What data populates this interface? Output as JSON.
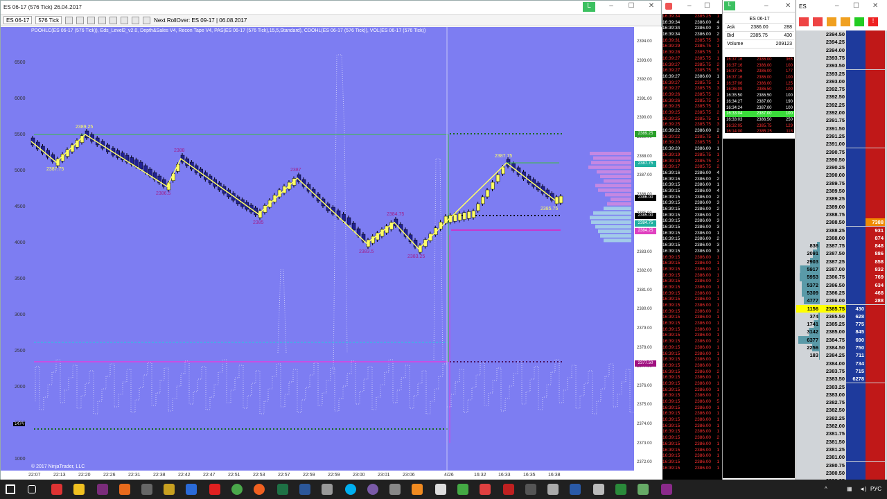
{
  "chart_window": {
    "title": "ES 06-17 (576 Tick)  26.04.2017",
    "instrument": "ES 06-17",
    "period": "576 Tick",
    "rollover": "Next RollOver:  ES 09-17 | 06.08.2017",
    "indicators": "PDOHLC(ES 06-17 (576 Tick)), Eds_Level2_v2.0, Depth&Sales V4, Recon Tape V4, PAS(ES 06-17 (576 Tick),15,5,Standard), CDOHL(ES 06-17 (576 Tick)), VOL(ES 06-17 (576 Tick))",
    "copyright": "© 2017 NinjaTrader, LLC",
    "panel_badge": "1474",
    "left_axis": [
      "6500",
      "6000",
      "5500",
      "5000",
      "4500",
      "4000",
      "3500",
      "3000",
      "2500",
      "2000",
      "1500",
      "1000"
    ],
    "right_axis": [
      "2394.00",
      "2393.00",
      "2392.00",
      "2391.00",
      "2390.00",
      "2389.00",
      "2388.00",
      "2387.00",
      "2386.00",
      "2385.00",
      "2384.00",
      "2383.00",
      "2382.00",
      "2381.00",
      "2380.00",
      "2379.00",
      "2378.00",
      "2377.00",
      "2376.00",
      "2375.00",
      "2374.00",
      "2373.00",
      "2372.00"
    ],
    "price_tags": [
      {
        "label": "2389.25",
        "color": "#2aa02a"
      },
      {
        "label": "2387.75",
        "color": "#20b0a0"
      },
      {
        "label": "2386.00",
        "color": "#000000"
      },
      {
        "label": "2385.00",
        "color": "#000000"
      },
      {
        "label": "2384.75",
        "color": "#20b0a0"
      },
      {
        "label": "2384.25",
        "color": "#e040c0"
      },
      {
        "label": "2377.50",
        "color": "#a01080"
      }
    ],
    "x_axis": [
      "22:07",
      "22:13",
      "22:20",
      "22:26",
      "22:31",
      "22:38",
      "22:42",
      "22:47",
      "22:51",
      "22:53",
      "22:57",
      "22:59",
      "22:59",
      "23:00",
      "23:01",
      "23:06",
      "4/26",
      "16:32",
      "16:33",
      "16:35",
      "16:38"
    ],
    "swing_labels": [
      {
        "text": "2389.25",
        "kind": "high"
      },
      {
        "text": "2387.75",
        "kind": "high"
      },
      {
        "text": "2388",
        "kind": "low"
      },
      {
        "text": "2386.5",
        "kind": "low"
      },
      {
        "text": "2387",
        "kind": "low"
      },
      {
        "text": "2385",
        "kind": "low"
      },
      {
        "text": "2384.75",
        "kind": "low"
      },
      {
        "text": "2383.5",
        "kind": "low"
      },
      {
        "text": "2383.25",
        "kind": "low"
      },
      {
        "text": "2387.75",
        "kind": "high"
      },
      {
        "text": "2385.75",
        "kind": "high"
      }
    ]
  },
  "tape": {
    "rows": [
      {
        "t": "16:39:34",
        "p": "2385.25",
        "s": "1",
        "c": "#ff3030"
      },
      {
        "t": "16:39:34",
        "p": "2386.00",
        "s": "4",
        "c": "#ffffff"
      },
      {
        "t": "16:39:34",
        "p": "2386.00",
        "s": "3",
        "c": "#ffffff"
      },
      {
        "t": "16:39:34",
        "p": "2386.00",
        "s": "2",
        "c": "#ffffff"
      },
      {
        "t": "16:39:31",
        "p": "2385.75",
        "s": "3",
        "c": "#ff3030"
      },
      {
        "t": "16:39:29",
        "p": "2385.75",
        "s": "1",
        "c": "#ff3030"
      },
      {
        "t": "16:39:28",
        "p": "2385.75",
        "s": "1",
        "c": "#ff3030"
      },
      {
        "t": "16:39:27",
        "p": "2385.75",
        "s": "1",
        "c": "#ff3030"
      },
      {
        "t": "16:39:27",
        "p": "2385.75",
        "s": "2",
        "c": "#ff3030"
      },
      {
        "t": "16:39:27",
        "p": "2385.75",
        "s": "5",
        "c": "#ff3030"
      },
      {
        "t": "16:39:27",
        "p": "2386.00",
        "s": "1",
        "c": "#ffffff"
      },
      {
        "t": "16:39:27",
        "p": "2385.75",
        "s": "1",
        "c": "#ff3030"
      },
      {
        "t": "16:39:27",
        "p": "2385.75",
        "s": "3",
        "c": "#ff3030"
      },
      {
        "t": "16:39:26",
        "p": "2385.75",
        "s": "1",
        "c": "#ff3030"
      },
      {
        "t": "16:39:26",
        "p": "2385.75",
        "s": "5",
        "c": "#ff3030"
      },
      {
        "t": "16:39:25",
        "p": "2385.75",
        "s": "1",
        "c": "#ff3030"
      },
      {
        "t": "16:39:25",
        "p": "2385.75",
        "s": "2",
        "c": "#ff3030"
      },
      {
        "t": "16:39:25",
        "p": "2385.75",
        "s": "1",
        "c": "#ff3030"
      },
      {
        "t": "16:39:25",
        "p": "2385.75",
        "s": "3",
        "c": "#ff3030"
      },
      {
        "t": "16:39:22",
        "p": "2386.00",
        "s": "2",
        "c": "#ffffff"
      },
      {
        "t": "16:39:22",
        "p": "2385.75",
        "s": "1",
        "c": "#ff3030"
      },
      {
        "t": "16:39:20",
        "p": "2385.75",
        "s": "1",
        "c": "#ff3030"
      },
      {
        "t": "16:39:20",
        "p": "2386.00",
        "s": "1",
        "c": "#ffffff"
      },
      {
        "t": "16:39:19",
        "p": "2385.75",
        "s": "1",
        "c": "#ff3030"
      },
      {
        "t": "16:39:19",
        "p": "2385.75",
        "s": "2",
        "c": "#ff3030"
      },
      {
        "t": "16:39:17",
        "p": "2385.75",
        "s": "2",
        "c": "#ff3030"
      },
      {
        "t": "16:39:16",
        "p": "2386.00",
        "s": "4",
        "c": "#ffffff"
      },
      {
        "t": "16:39:16",
        "p": "2386.00",
        "s": "2",
        "c": "#ffffff"
      },
      {
        "t": "16:39:15",
        "p": "2386.00",
        "s": "1",
        "c": "#ffffff"
      },
      {
        "t": "16:39:15",
        "p": "2386.00",
        "s": "4",
        "c": "#ffffff"
      },
      {
        "t": "16:39:15",
        "p": "2386.00",
        "s": "2",
        "c": "#ffffff"
      },
      {
        "t": "16:39:15",
        "p": "2386.00",
        "s": "3",
        "c": "#ffffff"
      },
      {
        "t": "16:39:15",
        "p": "2386.00",
        "s": "2",
        "c": "#ffffff"
      },
      {
        "t": "16:39:15",
        "p": "2386.00",
        "s": "2",
        "c": "#ffffff"
      },
      {
        "t": "16:39:15",
        "p": "2386.00",
        "s": "3",
        "c": "#ffffff"
      },
      {
        "t": "16:39:15",
        "p": "2386.00",
        "s": "3",
        "c": "#ffffff"
      },
      {
        "t": "16:39:15",
        "p": "2386.00",
        "s": "1",
        "c": "#ffffff"
      },
      {
        "t": "16:39:15",
        "p": "2386.00",
        "s": "2",
        "c": "#ffffff"
      },
      {
        "t": "16:39:15",
        "p": "2386.00",
        "s": "3",
        "c": "#ffffff"
      },
      {
        "t": "16:39:15",
        "p": "2386.00",
        "s": "3",
        "c": "#ffffff"
      },
      {
        "t": "16:39:15",
        "p": "2386.00",
        "s": "1",
        "c": "#ff3030"
      },
      {
        "t": "16:39:15",
        "p": "2386.00",
        "s": "1",
        "c": "#ff3030"
      },
      {
        "t": "16:39:15",
        "p": "2386.00",
        "s": "1",
        "c": "#ff3030"
      },
      {
        "t": "16:39:15",
        "p": "2386.00",
        "s": "1",
        "c": "#ff3030"
      },
      {
        "t": "16:39:15",
        "p": "2386.00",
        "s": "2",
        "c": "#ff3030"
      },
      {
        "t": "16:39:15",
        "p": "2386.00",
        "s": "1",
        "c": "#ff3030"
      },
      {
        "t": "16:39:15",
        "p": "2386.00",
        "s": "1",
        "c": "#ff3030"
      },
      {
        "t": "16:39:15",
        "p": "2386.00",
        "s": "1",
        "c": "#ff3030"
      },
      {
        "t": "16:39:15",
        "p": "2386.00",
        "s": "1",
        "c": "#ff3030"
      },
      {
        "t": "16:39:15",
        "p": "2386.00",
        "s": "2",
        "c": "#ff3030"
      },
      {
        "t": "16:39:15",
        "p": "2386.00",
        "s": "1",
        "c": "#ff3030"
      },
      {
        "t": "16:39:15",
        "p": "2386.00",
        "s": "1",
        "c": "#ff3030"
      },
      {
        "t": "16:39:15",
        "p": "2386.00",
        "s": "1",
        "c": "#ff3030"
      },
      {
        "t": "16:39:15",
        "p": "2386.00",
        "s": "1",
        "c": "#ff3030"
      },
      {
        "t": "16:39:15",
        "p": "2386.00",
        "s": "2",
        "c": "#ff3030"
      },
      {
        "t": "16:39:15",
        "p": "2386.00",
        "s": "1",
        "c": "#ff3030"
      },
      {
        "t": "16:39:15",
        "p": "2386.00",
        "s": "1",
        "c": "#ff3030"
      },
      {
        "t": "16:39:15",
        "p": "2386.00",
        "s": "1",
        "c": "#ff3030"
      },
      {
        "t": "16:39:15",
        "p": "2386.00",
        "s": "1",
        "c": "#ff3030"
      },
      {
        "t": "16:39:15",
        "p": "2386.00",
        "s": "2",
        "c": "#ff3030"
      },
      {
        "t": "16:39:15",
        "p": "2386.00",
        "s": "1",
        "c": "#ff3030"
      },
      {
        "t": "16:39:15",
        "p": "2386.00",
        "s": "1",
        "c": "#ff3030"
      },
      {
        "t": "16:39:15",
        "p": "2386.00",
        "s": "1",
        "c": "#ff3030"
      },
      {
        "t": "16:39:15",
        "p": "2386.00",
        "s": "1",
        "c": "#ff3030"
      },
      {
        "t": "16:39:15",
        "p": "2386.00",
        "s": "5",
        "c": "#ff3030"
      },
      {
        "t": "16:39:15",
        "p": "2386.00",
        "s": "1",
        "c": "#ff3030"
      },
      {
        "t": "16:39:15",
        "p": "2386.00",
        "s": "1",
        "c": "#ff3030"
      },
      {
        "t": "16:39:15",
        "p": "2386.00",
        "s": "1",
        "c": "#ff3030"
      },
      {
        "t": "16:39:15",
        "p": "2386.00",
        "s": "1",
        "c": "#ff3030"
      },
      {
        "t": "16:39:15",
        "p": "2386.00",
        "s": "1",
        "c": "#ff3030"
      },
      {
        "t": "16:39:15",
        "p": "2386.00",
        "s": "2",
        "c": "#ff3030"
      },
      {
        "t": "16:39:15",
        "p": "2386.00",
        "s": "1",
        "c": "#ff3030"
      },
      {
        "t": "16:39:15",
        "p": "2386.00",
        "s": "1",
        "c": "#ff3030"
      },
      {
        "t": "16:39:15",
        "p": "2386.00",
        "s": "1",
        "c": "#ff3030"
      },
      {
        "t": "16:39:15",
        "p": "2386.00",
        "s": "1",
        "c": "#ff3030"
      },
      {
        "t": "16:39:15",
        "p": "2386.00",
        "s": "1",
        "c": "#ff3030"
      }
    ]
  },
  "quote": {
    "title": "ES 06-17",
    "ask_label": "Ask",
    "ask_price": "2386.00",
    "ask_size": "288",
    "bid_label": "Bid",
    "bid_price": "2385.75",
    "bid_size": "430",
    "volume_label": "Volume",
    "volume": "209123"
  },
  "time_sales": [
    {
      "t": "16:37:16",
      "p": "2386.00",
      "s": "365",
      "k": "r"
    },
    {
      "t": "16:37:16",
      "p": "2386.00",
      "s": "100",
      "k": "r"
    },
    {
      "t": "16:37:16",
      "p": "2386.00",
      "s": "177",
      "k": "r"
    },
    {
      "t": "16:37:16",
      "p": "2386.00",
      "s": "100",
      "k": "r"
    },
    {
      "t": "16:37:06",
      "p": "2386.00",
      "s": "125",
      "k": "r"
    },
    {
      "t": "16:36:09",
      "p": "2386.50",
      "s": "100",
      "k": "r"
    },
    {
      "t": "16:35:50",
      "p": "2386.50",
      "s": "100",
      "k": "g"
    },
    {
      "t": "16:34:27",
      "p": "2387.00",
      "s": "190",
      "k": "g"
    },
    {
      "t": "16:34:24",
      "p": "2387.00",
      "s": "100",
      "k": "g"
    },
    {
      "t": "16:33:04",
      "p": "2387.00",
      "s": "100",
      "k": "hl"
    },
    {
      "t": "16:33:03",
      "p": "2386.50",
      "s": "250",
      "k": "g"
    },
    {
      "t": "16:32:05",
      "p": "2385.75",
      "s": "129",
      "k": "r"
    },
    {
      "t": "16:14:00",
      "p": "2385.25",
      "s": "118",
      "k": "r"
    }
  ],
  "ladder": {
    "rows": [
      {
        "vol": "",
        "price": "2394.50",
        "bid": "",
        "ask": ""
      },
      {
        "vol": "",
        "price": "2394.25",
        "bid": "",
        "ask": ""
      },
      {
        "vol": "",
        "price": "2394.00",
        "bid": "",
        "ask": ""
      },
      {
        "vol": "",
        "price": "2393.75",
        "bid": "",
        "ask": ""
      },
      {
        "vol": "",
        "price": "2393.50",
        "bid": "",
        "ask": ""
      },
      {
        "vol": "",
        "price": "2393.25",
        "bid": "",
        "ask": ""
      },
      {
        "vol": "",
        "price": "2393.00",
        "bid": "",
        "ask": ""
      },
      {
        "vol": "",
        "price": "2392.75",
        "bid": "",
        "ask": ""
      },
      {
        "vol": "",
        "price": "2392.50",
        "bid": "",
        "ask": ""
      },
      {
        "vol": "",
        "price": "2392.25",
        "bid": "",
        "ask": ""
      },
      {
        "vol": "",
        "price": "2392.00",
        "bid": "",
        "ask": ""
      },
      {
        "vol": "",
        "price": "2391.75",
        "bid": "",
        "ask": ""
      },
      {
        "vol": "",
        "price": "2391.50",
        "bid": "",
        "ask": ""
      },
      {
        "vol": "",
        "price": "2391.25",
        "bid": "",
        "ask": ""
      },
      {
        "vol": "",
        "price": "2391.00",
        "bid": "",
        "ask": ""
      },
      {
        "vol": "",
        "price": "2390.75",
        "bid": "",
        "ask": ""
      },
      {
        "vol": "",
        "price": "2390.50",
        "bid": "",
        "ask": ""
      },
      {
        "vol": "",
        "price": "2390.25",
        "bid": "",
        "ask": ""
      },
      {
        "vol": "",
        "price": "2390.00",
        "bid": "",
        "ask": ""
      },
      {
        "vol": "",
        "price": "2389.75",
        "bid": "",
        "ask": ""
      },
      {
        "vol": "",
        "price": "2389.50",
        "bid": "",
        "ask": ""
      },
      {
        "vol": "",
        "price": "2389.25",
        "bid": "",
        "ask": ""
      },
      {
        "vol": "",
        "price": "2389.00",
        "bid": "",
        "ask": ""
      },
      {
        "vol": "",
        "price": "2388.75",
        "bid": "",
        "ask": ""
      },
      {
        "vol": "",
        "price": "2388.50",
        "bid": "",
        "ask": "7388"
      },
      {
        "vol": "",
        "price": "2388.25",
        "bid": "",
        "ask": "931"
      },
      {
        "vol": "",
        "price": "2388.00",
        "bid": "",
        "ask": "874"
      },
      {
        "vol": "836",
        "price": "2387.75",
        "bid": "",
        "ask": "848"
      },
      {
        "vol": "2091",
        "price": "2387.50",
        "bid": "",
        "ask": "886"
      },
      {
        "vol": "2903",
        "price": "2387.25",
        "bid": "",
        "ask": "858"
      },
      {
        "vol": "5917",
        "price": "2387.00",
        "bid": "",
        "ask": "832"
      },
      {
        "vol": "5953",
        "price": "2386.75",
        "bid": "",
        "ask": "769"
      },
      {
        "vol": "5372",
        "price": "2386.50",
        "bid": "",
        "ask": "634"
      },
      {
        "vol": "5309",
        "price": "2386.25",
        "bid": "",
        "ask": "468"
      },
      {
        "vol": "4777",
        "price": "2386.00",
        "bid": "",
        "ask": "288"
      },
      {
        "vol": "1156",
        "price": "2385.75",
        "bid": "430",
        "ask": ""
      },
      {
        "vol": "374",
        "price": "2385.50",
        "bid": "628",
        "ask": ""
      },
      {
        "vol": "1741",
        "price": "2385.25",
        "bid": "775",
        "ask": ""
      },
      {
        "vol": "3142",
        "price": "2385.00",
        "bid": "845",
        "ask": ""
      },
      {
        "vol": "6377",
        "price": "2384.75",
        "bid": "690",
        "ask": ""
      },
      {
        "vol": "2256",
        "price": "2384.50",
        "bid": "750",
        "ask": ""
      },
      {
        "vol": "183",
        "price": "2384.25",
        "bid": "711",
        "ask": ""
      },
      {
        "vol": "",
        "price": "2384.00",
        "bid": "734",
        "ask": ""
      },
      {
        "vol": "",
        "price": "2383.75",
        "bid": "715",
        "ask": ""
      },
      {
        "vol": "",
        "price": "2383.50",
        "bid": "6278",
        "ask": ""
      },
      {
        "vol": "",
        "price": "2383.25",
        "bid": "",
        "ask": ""
      },
      {
        "vol": "",
        "price": "2383.00",
        "bid": "",
        "ask": ""
      },
      {
        "vol": "",
        "price": "2382.75",
        "bid": "",
        "ask": ""
      },
      {
        "vol": "",
        "price": "2382.50",
        "bid": "",
        "ask": ""
      },
      {
        "vol": "",
        "price": "2382.25",
        "bid": "",
        "ask": ""
      },
      {
        "vol": "",
        "price": "2382.00",
        "bid": "",
        "ask": ""
      },
      {
        "vol": "",
        "price": "2381.75",
        "bid": "",
        "ask": ""
      },
      {
        "vol": "",
        "price": "2381.50",
        "bid": "",
        "ask": ""
      },
      {
        "vol": "",
        "price": "2381.25",
        "bid": "",
        "ask": ""
      },
      {
        "vol": "",
        "price": "2381.00",
        "bid": "",
        "ask": ""
      },
      {
        "vol": "",
        "price": "2380.75",
        "bid": "",
        "ask": ""
      },
      {
        "vol": "",
        "price": "2380.50",
        "bid": "",
        "ask": ""
      },
      {
        "vol": "",
        "price": "2380.25",
        "bid": "",
        "ask": ""
      }
    ],
    "last_price": "2385.75"
  },
  "taskbar": {
    "lang": "РУС",
    "tray_date": ""
  }
}
